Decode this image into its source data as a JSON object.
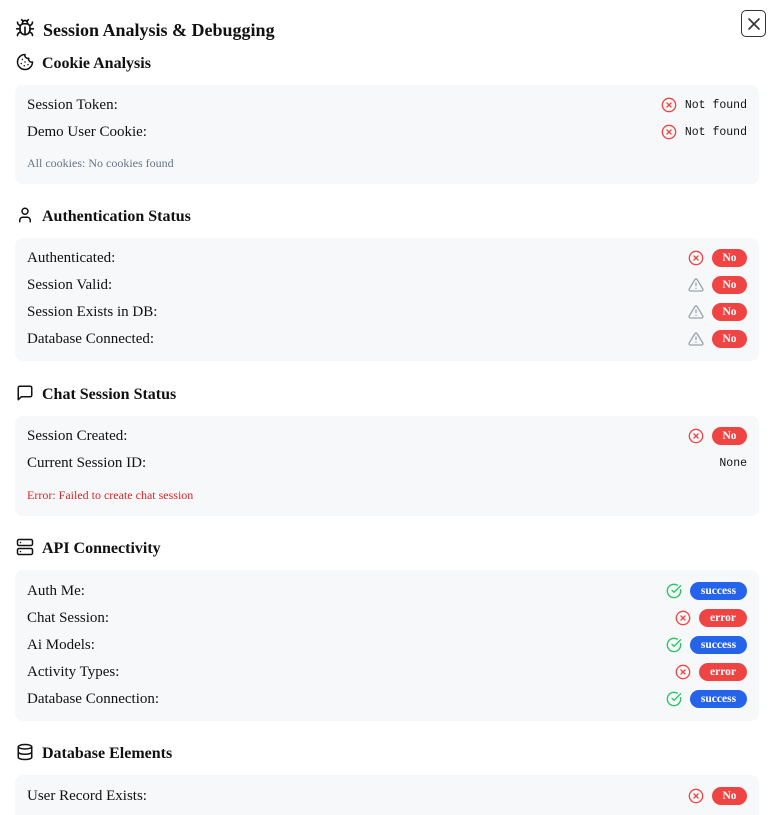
{
  "dialog": {
    "title": "Session Analysis & Debugging"
  },
  "colors": {
    "error": "#ef4444",
    "success": "#2563eb",
    "ok_icon": "#22c55e",
    "warn_icon": "#9ca3af",
    "panel_bg": "#f7f8fa"
  },
  "cookie": {
    "title": "Cookie Analysis",
    "rows": [
      {
        "label": "Session Token:",
        "value": "Not found",
        "icon": "x-circle-icon"
      },
      {
        "label": "Demo User Cookie:",
        "value": "Not found",
        "icon": "x-circle-icon"
      }
    ],
    "note": "All cookies: No cookies found"
  },
  "auth": {
    "title": "Authentication Status",
    "rows": [
      {
        "label": "Authenticated:",
        "value": "No",
        "icon": "x-circle-icon"
      },
      {
        "label": "Session Valid:",
        "value": "No",
        "icon": "warning-icon"
      },
      {
        "label": "Session Exists in DB:",
        "value": "No",
        "icon": "warning-icon"
      },
      {
        "label": "Database Connected:",
        "value": "No",
        "icon": "warning-icon"
      }
    ]
  },
  "chat": {
    "title": "Chat Session Status",
    "rows": [
      {
        "label": "Session Created:",
        "value": "No",
        "icon": "x-circle-icon"
      },
      {
        "label": "Current Session ID:",
        "value": "None"
      }
    ],
    "error": "Error: Failed to create chat session"
  },
  "api": {
    "title": "API Connectivity",
    "rows": [
      {
        "label": "Auth Me:",
        "value": "success",
        "icon": "check-circle-icon"
      },
      {
        "label": "Chat Session:",
        "value": "error",
        "icon": "x-circle-icon"
      },
      {
        "label": "Ai Models:",
        "value": "success",
        "icon": "check-circle-icon"
      },
      {
        "label": "Activity Types:",
        "value": "error",
        "icon": "x-circle-icon"
      },
      {
        "label": "Database Connection:",
        "value": "success",
        "icon": "check-circle-icon"
      }
    ]
  },
  "db": {
    "title": "Database Elements",
    "rows": [
      {
        "label": "User Record Exists:",
        "value": "No",
        "icon": "x-circle-icon"
      }
    ]
  }
}
